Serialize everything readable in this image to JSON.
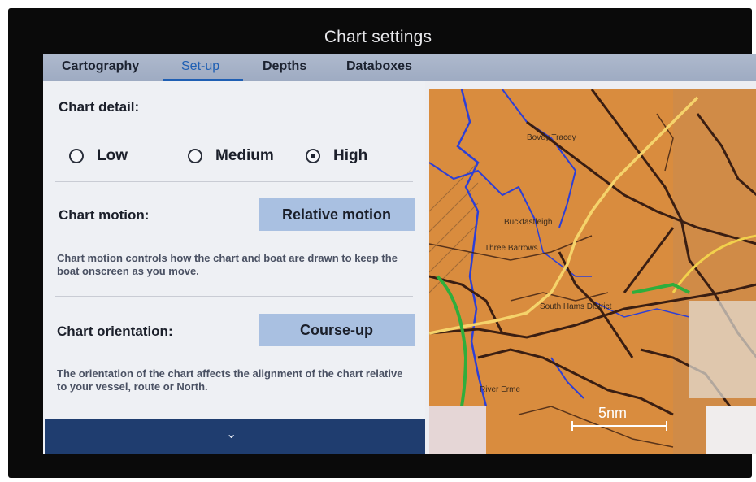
{
  "window": {
    "title": "Chart settings"
  },
  "tabs": [
    {
      "label": "Cartography"
    },
    {
      "label": "Set-up",
      "active": true
    },
    {
      "label": "Depths"
    },
    {
      "label": "Databoxes"
    }
  ],
  "chart_detail": {
    "label": "Chart detail:",
    "options": [
      {
        "label": "Low",
        "selected": false
      },
      {
        "label": "Medium",
        "selected": false
      },
      {
        "label": "High",
        "selected": true
      }
    ]
  },
  "chart_motion": {
    "label": "Chart motion:",
    "button_label": "Relative motion",
    "description": "Chart motion controls how the chart and boat are drawn to keep the boat onscreen as you move."
  },
  "chart_orientation": {
    "label": "Chart orientation:",
    "button_label": "Course-up",
    "description": "The orientation of the chart affects the alignment of the chart relative to your vessel, route or North."
  },
  "map": {
    "scale_label": "5nm",
    "places": [
      "Bovey Tracey",
      "Buckfastleigh",
      "Three Barrows",
      "South Hams District",
      "River Erme"
    ],
    "colors": {
      "land": "#d98c3e",
      "water": "#2d3fd6",
      "roads": "#3a1e12",
      "route": "#f2c94c",
      "track": "#2fae3c"
    }
  },
  "icons": {
    "expand": "chevron-down-icon"
  }
}
